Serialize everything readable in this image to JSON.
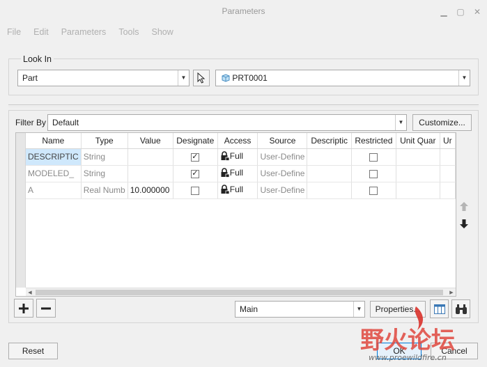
{
  "window": {
    "title": "Parameters"
  },
  "menu": [
    "File",
    "Edit",
    "Parameters",
    "Tools",
    "Show"
  ],
  "look_in": {
    "label": "Look In",
    "type_value": "Part",
    "model_value": "PRT0001"
  },
  "filter": {
    "label": "Filter By",
    "value": "Default",
    "customize_label": "Customize..."
  },
  "table": {
    "columns": [
      "Name",
      "Type",
      "Value",
      "Designate",
      "Access",
      "Source",
      "Descriptic",
      "Restricted",
      "Unit Quar",
      "Ur"
    ],
    "rows": [
      {
        "name": "DESCRIPTIC",
        "type": "String",
        "value": "",
        "designate": true,
        "access": "Full",
        "source": "User-Define",
        "restricted": false
      },
      {
        "name": "MODELED_",
        "type": "String",
        "value": "",
        "designate": true,
        "access": "Full",
        "source": "User-Define",
        "restricted": false
      },
      {
        "name": "A",
        "type": "Real Numb",
        "value": "10.000000",
        "designate": false,
        "access": "Full",
        "source": "User-Define",
        "restricted": false
      }
    ]
  },
  "bottom": {
    "view_value": "Main",
    "properties_label": "Properties...",
    "reset_label": "Reset",
    "ok_label": "OK",
    "cancel_label": "Cancel"
  },
  "watermark": {
    "cn_text": "野火论坛",
    "url_text": "www.proewildfire.cn"
  },
  "colors": {
    "selection": "#cfe8fc",
    "arrow_red": "#d9322b",
    "watermark_red": "#e0483e",
    "watermark_gray": "#555555"
  }
}
